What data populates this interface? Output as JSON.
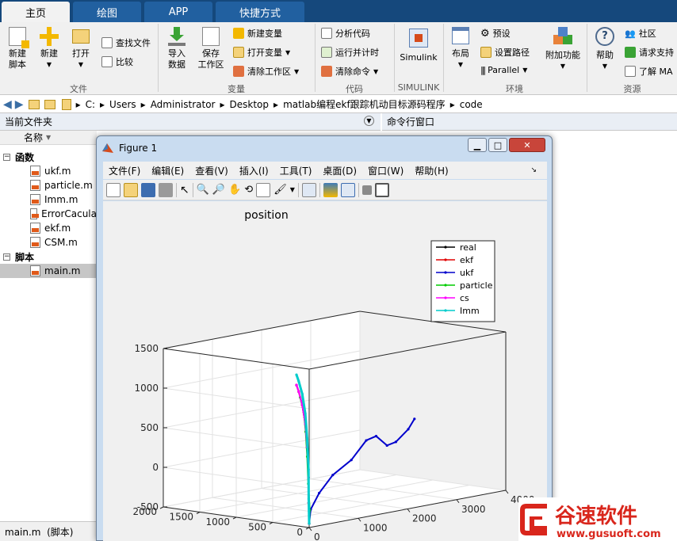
{
  "tabs": [
    "主页",
    "绘图",
    "APP",
    "快捷方式"
  ],
  "ribbon": {
    "file_group": {
      "label": "文件",
      "new_script": "新建\n脚本",
      "new": "新建",
      "open": "打开",
      "find_files": "查找文件",
      "compare": "比较"
    },
    "variable_group": {
      "label": "变量",
      "import": "导入\n数据",
      "save_workspace": "保存\n工作区",
      "new_variable": "新建变量",
      "open_variable": "打开变量",
      "clear_workspace": "清除工作区"
    },
    "code_group": {
      "label": "代码",
      "analyze": "分析代码",
      "run_timing": "运行并计时",
      "clear_commands": "清除命令"
    },
    "simulink_group": {
      "label": "SIMULINK",
      "simulink": "Simulink"
    },
    "env_group": {
      "label": "环境",
      "layout": "布局",
      "preferences": "预设",
      "set_path": "设置路径",
      "parallel": "Parallel",
      "addons": "附加功能"
    },
    "resources_group": {
      "label": "资源",
      "help": "帮助",
      "community": "社区",
      "request_support": "请求支持",
      "learn": "了解 MA"
    }
  },
  "address": {
    "path": [
      "C:",
      "Users",
      "Administrator",
      "Desktop",
      "matlab编程ekf跟踪机动目标源码程序",
      "code"
    ]
  },
  "current_folder": {
    "title": "当前文件夹",
    "name_header": "名称",
    "functions_label": "函数",
    "functions": [
      "ukf.m",
      "particle.m",
      "Imm.m",
      "ErrorCacula",
      "ekf.m",
      "CSM.m"
    ],
    "scripts_label": "脚本",
    "scripts": [
      "main.m"
    ]
  },
  "command_window": {
    "title": "命令行窗口"
  },
  "status": "main.m  (脚本)",
  "figure": {
    "title": "Figure 1",
    "menu": [
      "文件(F)",
      "编辑(E)",
      "查看(V)",
      "插入(I)",
      "工具(T)",
      "桌面(D)",
      "窗口(W)",
      "帮助(H)"
    ]
  },
  "watermark": {
    "name": "谷速软件",
    "url": "www.gusuoft.com"
  },
  "chart_data": {
    "type": "line",
    "title": "position",
    "xlabel": "",
    "ylabel": "",
    "zlabel": "",
    "xlim": [
      0,
      4000
    ],
    "ylim": [
      0,
      2000
    ],
    "zlim": [
      -500,
      1500
    ],
    "xticks": [
      0,
      1000,
      2000,
      3000,
      4000
    ],
    "yticks": [
      0,
      500,
      1000,
      1500,
      2000
    ],
    "zticks": [
      -500,
      0,
      500,
      1000,
      1500
    ],
    "grid": true,
    "legend_position": "top-right",
    "series": [
      {
        "name": "real",
        "color": "#000000",
        "points": [
          [
            0,
            0,
            -450
          ],
          [
            50,
            40,
            -200
          ],
          [
            150,
            110,
            100
          ],
          [
            300,
            230,
            450
          ],
          [
            500,
            390,
            700
          ],
          [
            750,
            600,
            880
          ],
          [
            1050,
            850,
            980
          ],
          [
            1300,
            1050,
            1010
          ]
        ]
      },
      {
        "name": "ekf",
        "color": "#e00000",
        "points": [
          [
            0,
            0,
            -450
          ],
          [
            50,
            40,
            -200
          ],
          [
            150,
            110,
            100
          ],
          [
            300,
            230,
            450
          ],
          [
            500,
            390,
            700
          ],
          [
            750,
            600,
            880
          ],
          [
            1050,
            850,
            980
          ],
          [
            1300,
            1050,
            1010
          ]
        ]
      },
      {
        "name": "ukf",
        "color": "#0000cc",
        "points": [
          [
            0,
            0,
            -450
          ],
          [
            150,
            80,
            -300
          ],
          [
            500,
            200,
            -150
          ],
          [
            1000,
            350,
            0
          ],
          [
            1600,
            500,
            100
          ],
          [
            2200,
            700,
            250
          ],
          [
            2550,
            800,
            250
          ],
          [
            2800,
            820,
            100
          ],
          [
            3100,
            900,
            100
          ],
          [
            3500,
            1000,
            200
          ],
          [
            3700,
            1050,
            300
          ]
        ]
      },
      {
        "name": "particle",
        "color": "#00cc00",
        "points": [
          [
            0,
            0,
            -450
          ],
          [
            100,
            60,
            -300
          ],
          [
            250,
            180,
            0
          ],
          [
            450,
            330,
            300
          ],
          [
            700,
            520,
            560
          ],
          [
            1000,
            750,
            760
          ],
          [
            1300,
            1000,
            860
          ]
        ]
      },
      {
        "name": "cs",
        "color": "#ff00ff",
        "points": [
          [
            0,
            0,
            -450
          ],
          [
            50,
            40,
            -200
          ],
          [
            150,
            110,
            100
          ],
          [
            300,
            230,
            450
          ],
          [
            500,
            390,
            700
          ],
          [
            750,
            600,
            880
          ],
          [
            1050,
            850,
            980
          ],
          [
            1300,
            1050,
            1010
          ]
        ]
      },
      {
        "name": "Imm",
        "color": "#00cccc",
        "points": [
          [
            0,
            0,
            -450
          ],
          [
            50,
            40,
            -150
          ],
          [
            150,
            110,
            200
          ],
          [
            300,
            230,
            560
          ],
          [
            500,
            390,
            830
          ],
          [
            750,
            600,
            1020
          ],
          [
            1050,
            850,
            1110
          ],
          [
            1300,
            1050,
            1140
          ]
        ]
      }
    ]
  }
}
